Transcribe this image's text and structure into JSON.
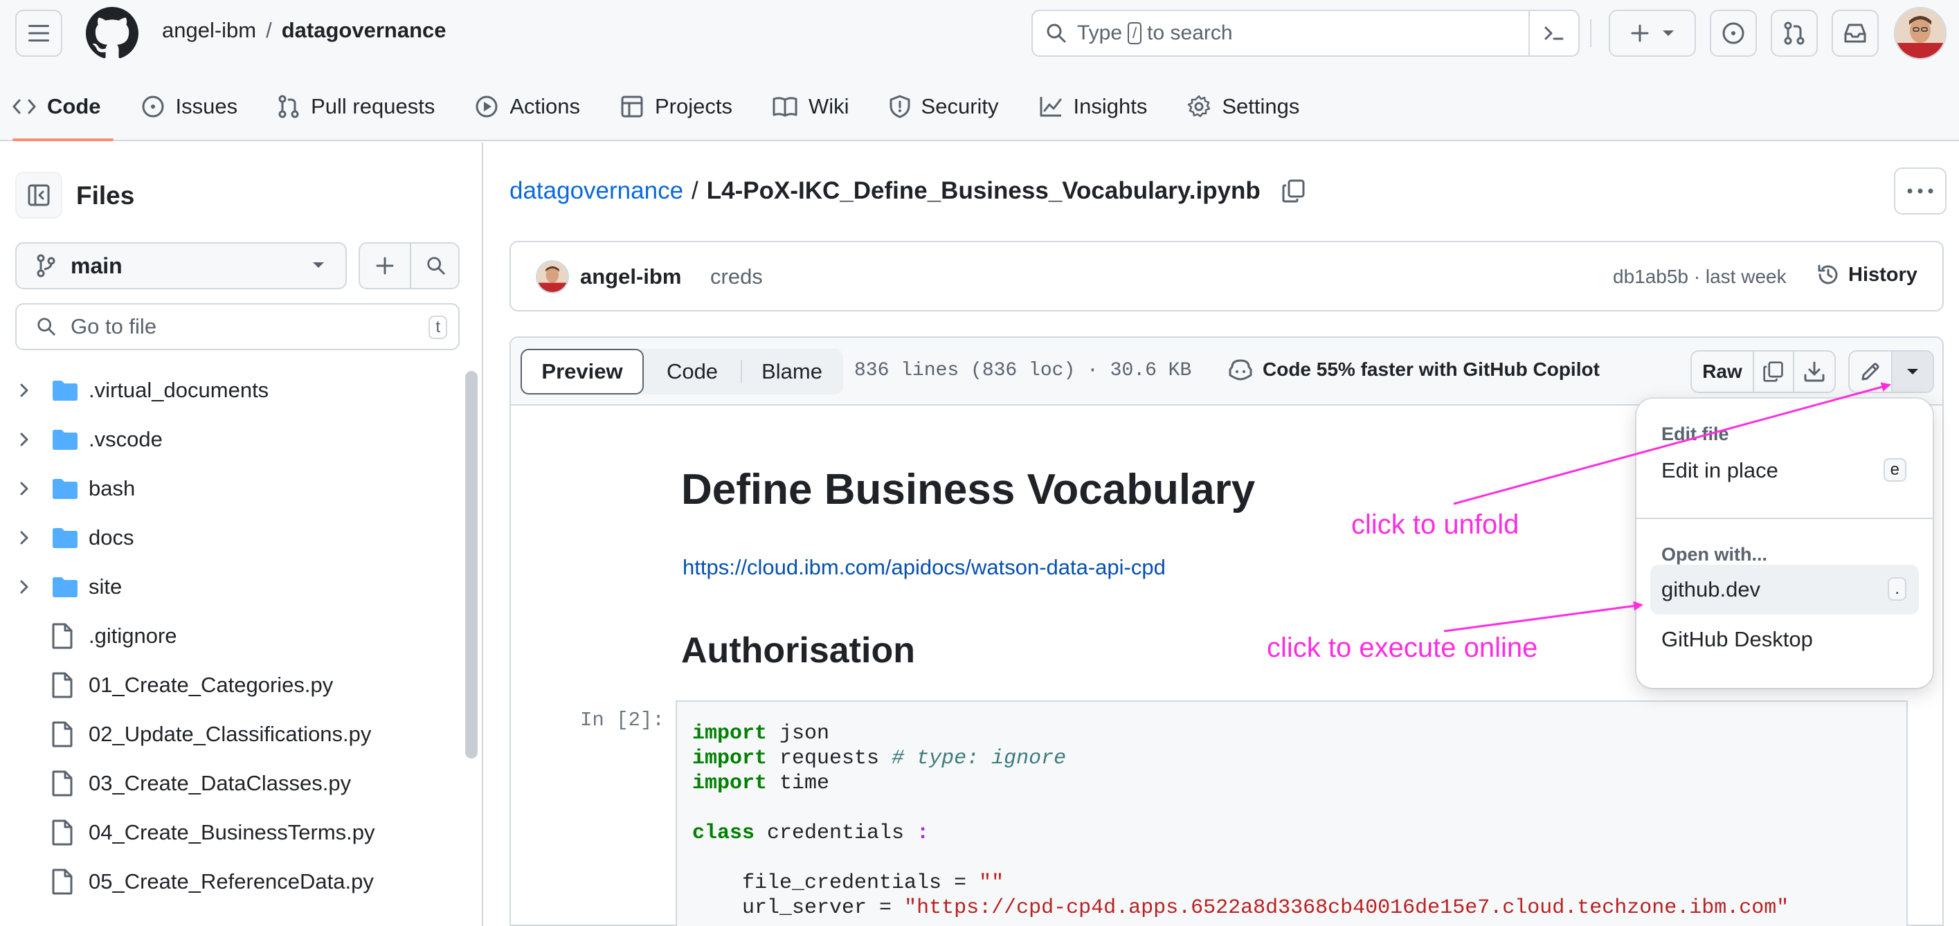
{
  "header": {
    "owner": "angel-ibm",
    "separator": "/",
    "repo": "datagovernance",
    "search_prefix": "Type",
    "search_kbd": "/",
    "search_suffix": "to search"
  },
  "tabs": [
    {
      "label": "Code",
      "icon": "code-icon"
    },
    {
      "label": "Issues",
      "icon": "issue-opened-icon"
    },
    {
      "label": "Pull requests",
      "icon": "git-pull-request-icon"
    },
    {
      "label": "Actions",
      "icon": "play-icon"
    },
    {
      "label": "Projects",
      "icon": "table-icon"
    },
    {
      "label": "Wiki",
      "icon": "book-icon"
    },
    {
      "label": "Security",
      "icon": "shield-icon"
    },
    {
      "label": "Insights",
      "icon": "graph-icon"
    },
    {
      "label": "Settings",
      "icon": "gear-icon"
    }
  ],
  "sidebar": {
    "title": "Files",
    "branch": "main",
    "goto_placeholder": "Go to file",
    "goto_kbd": "t",
    "tree": [
      {
        "name": ".virtual_documents",
        "type": "folder"
      },
      {
        "name": ".vscode",
        "type": "folder"
      },
      {
        "name": "bash",
        "type": "folder"
      },
      {
        "name": "docs",
        "type": "folder"
      },
      {
        "name": "site",
        "type": "folder"
      },
      {
        "name": ".gitignore",
        "type": "file"
      },
      {
        "name": "01_Create_Categories.py",
        "type": "file"
      },
      {
        "name": "02_Update_Classifications.py",
        "type": "file"
      },
      {
        "name": "03_Create_DataClasses.py",
        "type": "file"
      },
      {
        "name": "04_Create_BusinessTerms.py",
        "type": "file"
      },
      {
        "name": "05_Create_ReferenceData.py",
        "type": "file"
      }
    ]
  },
  "file": {
    "breadcrumb_repo": "datagovernance",
    "breadcrumb_sep": "/",
    "filename": "L4-PoX-IKC_Define_Business_Vocabulary.ipynb"
  },
  "commit": {
    "author": "angel-ibm",
    "message": "creds",
    "meta": "db1ab5b · last week",
    "history_label": "History"
  },
  "toolbar": {
    "preview": "Preview",
    "code": "Code",
    "blame": "Blame",
    "lines_info": "836 lines (836 loc) · 30.6 KB",
    "copilot": "Code 55% faster with GitHub Copilot",
    "raw": "Raw"
  },
  "notebook": {
    "title": "Define Business Vocabulary",
    "link": "https://cloud.ibm.com/apidocs/watson-data-api-cpd",
    "heading2": "Authorisation",
    "in_label": "In [2]:",
    "code_lines": [
      [
        "import",
        " json"
      ],
      [
        "import",
        " requests ",
        "# type: ignore"
      ],
      [
        "import",
        " time"
      ],
      [
        "class",
        " credentials ",
        ":"
      ],
      [
        "    file_credentials = ",
        "\"\""
      ],
      [
        "    url_server = ",
        "\"https://cpd-cp4d.apps.6522a8d3368cb40016de15e7.cloud.techzone.ibm.com\""
      ]
    ]
  },
  "dropdown": {
    "group1": "Edit file",
    "item_edit": "Edit in place",
    "item_edit_kbd": "e",
    "group2": "Open with...",
    "item_githubdev": "github.dev",
    "item_githubdev_kbd": ".",
    "item_desktop": "GitHub Desktop"
  },
  "annotations": {
    "unfold": "click to unfold",
    "execute": "click to execute online",
    "color": "#ff2de0"
  },
  "colors": {
    "accent_link": "#0969da",
    "tab_underline": "#fd8c73",
    "folder": "#54aeff"
  }
}
